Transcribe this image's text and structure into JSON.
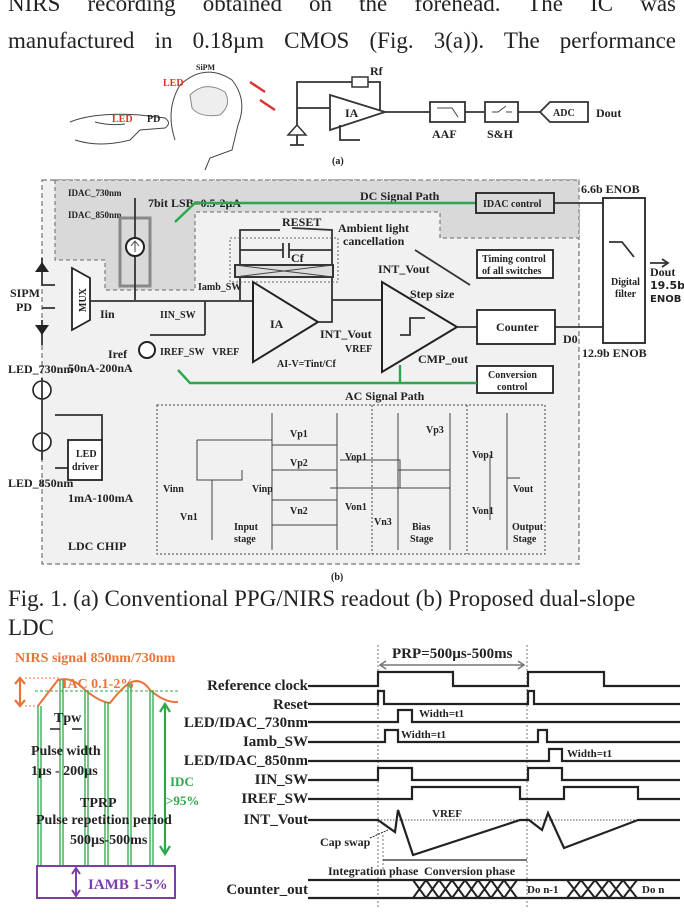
{
  "body_text": {
    "line1": "NIRS recording obtained on the forehead. The IC was",
    "line2": "manufactured in 0.18µm CMOS (Fig. 3(a)). The performance"
  },
  "fig_a": {
    "sipm": "SiPM",
    "led_head": "LED",
    "led_finger": "LED",
    "pd": "PD",
    "rf": "Rf",
    "ia": "IA",
    "aaf": "AAF",
    "sh": "S&H",
    "adc": "ADC",
    "dout": "Dout",
    "label": "(a)"
  },
  "fig_b": {
    "dc_path": "DC Signal Path",
    "ac_path": "AC Signal Path",
    "idac_730": "IDAC_730nm",
    "idac_850": "IDAC_850nm",
    "idac_lsb": "7bit LSB=0.5-2µA",
    "idac_control": "IDAC control",
    "enob_66": "6.6b ENOB",
    "enob_129": "12.9b ENOB",
    "digital_filter_1": "Digital",
    "digital_filter_2": "filter",
    "dout": "Dout",
    "dout_enob_1": "19.5b",
    "dout_enob_2": "ENOB",
    "reset": "RESET",
    "cf": "Cf",
    "ambient_1": "Ambient light",
    "ambient_2": "cancellation",
    "int_vout_ramp": "INT_Vout",
    "step_size": "Step size",
    "timing_control_1": "Timing control",
    "timing_control_2": "of all switches",
    "iamb_sw": "Iamb_SW",
    "sipm": "SIPM",
    "pd": "PD",
    "mux": "MUX",
    "iin": "Iin",
    "iin_sw": "IIN_SW",
    "iref_sw": "IREF_SW",
    "iref": "Iref",
    "iref_range": "50nA-200nA",
    "vref": "VREF",
    "ia": "IA",
    "gain": "AI-V=Tint/Cf",
    "int_vout": "INT_Vout",
    "vref_cmp": "VREF",
    "cmp_out": "CMP_out",
    "counter": "Counter",
    "d0": "D0",
    "conversion_control_1": "Conversion",
    "conversion_control_2": "control",
    "led_730": "LED_730nm",
    "led_850": "LED_850nm",
    "led_driver_1": "LED",
    "led_driver_2": "driver",
    "led_current": "1mA-100mA",
    "chip": "LDC CHIP",
    "schematic": {
      "vp1": "Vp1",
      "vp2": "Vp2",
      "vop1": "Vop1",
      "von1": "Von1",
      "vinn": "Vinn",
      "vinp": "Vinp",
      "vn1": "Vn1",
      "vn2": "Vn2",
      "vn3": "Vn3",
      "vp3": "Vp3",
      "vout": "Vout",
      "vop1_out": "Vop1",
      "von1_out": "Von1",
      "input_stage_1": "Input",
      "input_stage_2": "stage",
      "bias_stage_1": "Bias",
      "bias_stage_2": "Stage",
      "output_stage_1": "Output",
      "output_stage_2": "Stage"
    },
    "label": "(b)"
  },
  "caption": {
    "line1": "Fig. 1. (a) Conventional PPG/NIRS readout (b) Proposed dual-slope",
    "line2": "LDC"
  },
  "fig_c": {
    "nirs_signal": "NIRS signal 850nm/730nm",
    "iac": "IAC 0.1-2%",
    "tpw": "Tpw",
    "pulse_width": "Pulse width",
    "pulse_width_range": "1µs - 200µs",
    "tprp": "TPRP",
    "prp_label": "Pulse repetition period",
    "prp_range": "500µs-500ms",
    "idc": "IDC",
    "idc_pct": ">95%",
    "iamb": "IAMB 1-5%",
    "colors": {
      "signal": "#e8743b",
      "dc": "#2ca84a",
      "ambient": "#7b3fa8"
    }
  },
  "timing": {
    "prp": "PRP=500µs-500ms",
    "signals": [
      "Reference clock",
      "Reset",
      "LED/IDAC_730nm",
      "Iamb_SW",
      "LED/IDAC_850nm",
      "IIN_SW",
      "IREF_SW",
      "INT_Vout",
      "Counter_out"
    ],
    "width_730": "Width=t1",
    "width_amb": "Width=t1",
    "width_850": "Width=t1",
    "vref": "VREF",
    "cap_swap": "Cap swap",
    "integration_phase": "Integration phase",
    "conversion_phase": "Conversion phase",
    "do_prev": "Do n-1",
    "do_next": "Do n"
  }
}
